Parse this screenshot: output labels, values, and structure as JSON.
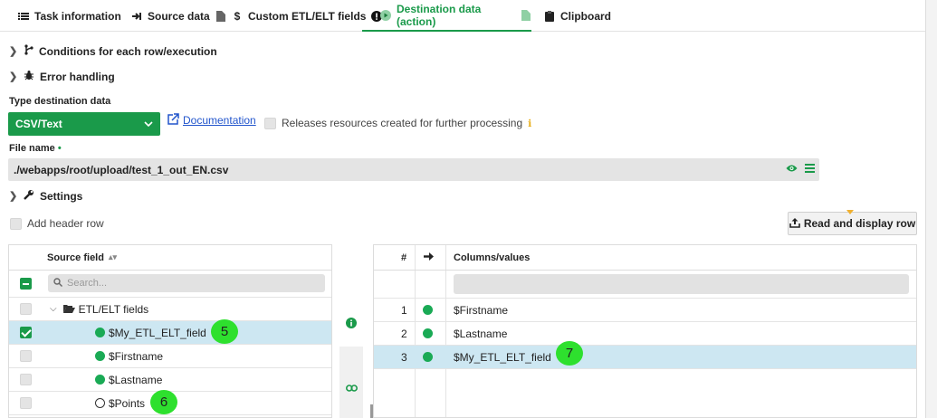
{
  "tabs": [
    {
      "label": "Task information",
      "icon": "list-icon"
    },
    {
      "label": "Source data",
      "icon": "arrow-in-icon"
    },
    {
      "label": "Custom ETL/ELT fields",
      "icon": "dollar-icon"
    },
    {
      "label": "Destination data (action)",
      "icon": "play-circle-icon"
    },
    {
      "label": "Clipboard",
      "icon": "clipboard-icon"
    }
  ],
  "sections": {
    "conditions": "Conditions for each row/execution",
    "error_handling": "Error handling",
    "settings": "Settings"
  },
  "destination": {
    "type_label": "Type destination data",
    "type_value": "CSV/Text",
    "documentation": "Documentation",
    "release_label": "Releases resources created for further processing"
  },
  "file": {
    "label": "File name",
    "required_mark": "•",
    "value": "./webapps/root/upload/test_1_out_EN.csv"
  },
  "header_row_label": "Add header row",
  "read_button": "Read and display row",
  "source_table": {
    "header": "Source field",
    "search_placeholder": "Search...",
    "group": "ETL/ELT fields",
    "rows": [
      {
        "label": "$My_ETL_ELT_field",
        "checked": true,
        "dot": "filled"
      },
      {
        "label": "$Firstname",
        "checked": false,
        "dot": "filled"
      },
      {
        "label": "$Lastname",
        "checked": false,
        "dot": "filled"
      },
      {
        "label": "$Points",
        "checked": false,
        "dot": "hollow"
      }
    ]
  },
  "dest_table": {
    "col_num": "#",
    "col_values": "Columns/values",
    "rows": [
      {
        "num": "1",
        "value": "$Firstname"
      },
      {
        "num": "2",
        "value": "$Lastname"
      },
      {
        "num": "3",
        "value": "$My_ETL_ELT_field"
      }
    ]
  },
  "badges": {
    "b5": "5",
    "b6": "6",
    "b7": "7"
  },
  "colors": {
    "accent": "#1a9a4a",
    "selected_row": "#cde7f2",
    "badge": "#2ee02e"
  }
}
